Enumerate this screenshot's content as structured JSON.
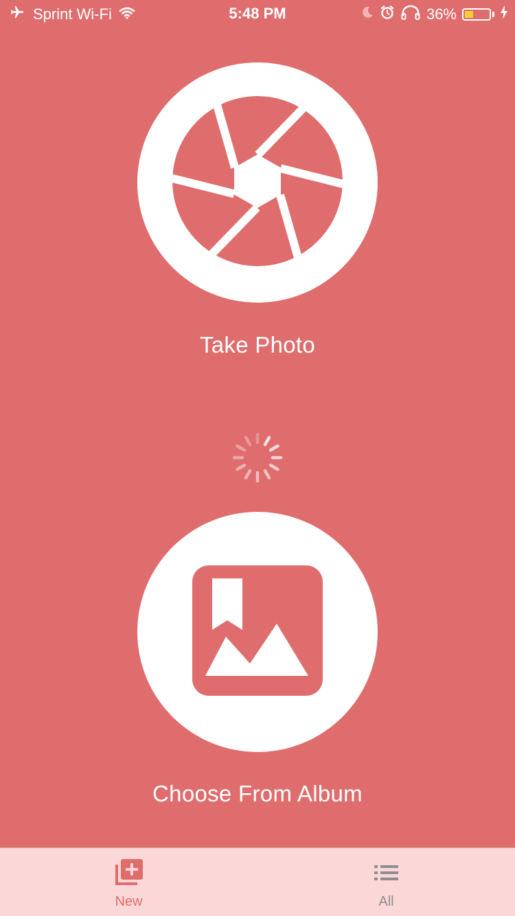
{
  "status_bar": {
    "carrier": "Sprint Wi-Fi",
    "time": "5:48 PM",
    "battery_percent": "36%",
    "battery_level": 0.36,
    "icons": [
      "airplane-icon",
      "wifi-icon",
      "moon-icon",
      "alarm-icon",
      "headphones-icon",
      "battery-icon",
      "charging-icon"
    ]
  },
  "main": {
    "take_photo_label": "Take Photo",
    "choose_album_label": "Choose From Album",
    "loading": true
  },
  "tab_bar": {
    "tabs": [
      {
        "label": "New",
        "icon": "add-collection-icon",
        "active": true
      },
      {
        "label": "All",
        "icon": "list-icon",
        "active": false
      }
    ]
  },
  "colors": {
    "background": "#E06D6D",
    "tab_bar_background": "#FCD7D7",
    "tab_active": "#E06D6D",
    "tab_inactive": "#8E8E8E",
    "battery_fill": "#F5D033"
  }
}
